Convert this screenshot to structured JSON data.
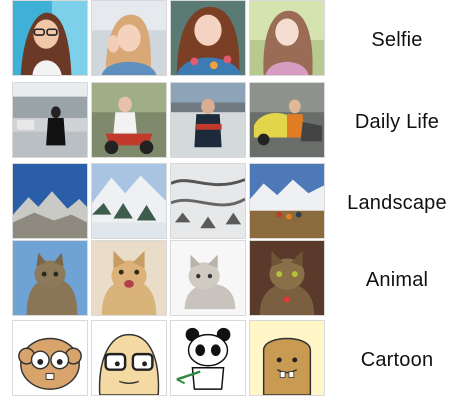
{
  "categories": [
    {
      "label": "Selfie",
      "thumbnails": [
        "selfie-photo",
        "selfie-photo",
        "selfie-photo",
        "selfie-photo"
      ]
    },
    {
      "label": "Daily Life",
      "thumbnails": [
        "daily-life-photo",
        "daily-life-photo",
        "daily-life-photo",
        "daily-life-photo"
      ]
    },
    {
      "label": "Landscape",
      "thumbnails": [
        "landscape-photo",
        "landscape-photo",
        "landscape-photo",
        "landscape-photo"
      ]
    },
    {
      "label": "Animal",
      "thumbnails": [
        "cat-photo",
        "cat-photo",
        "cat-photo",
        "cat-photo"
      ]
    },
    {
      "label": "Cartoon",
      "thumbnails": [
        "cartoon-drawing",
        "cartoon-drawing",
        "cartoon-drawing",
        "cartoon-drawing"
      ]
    }
  ]
}
